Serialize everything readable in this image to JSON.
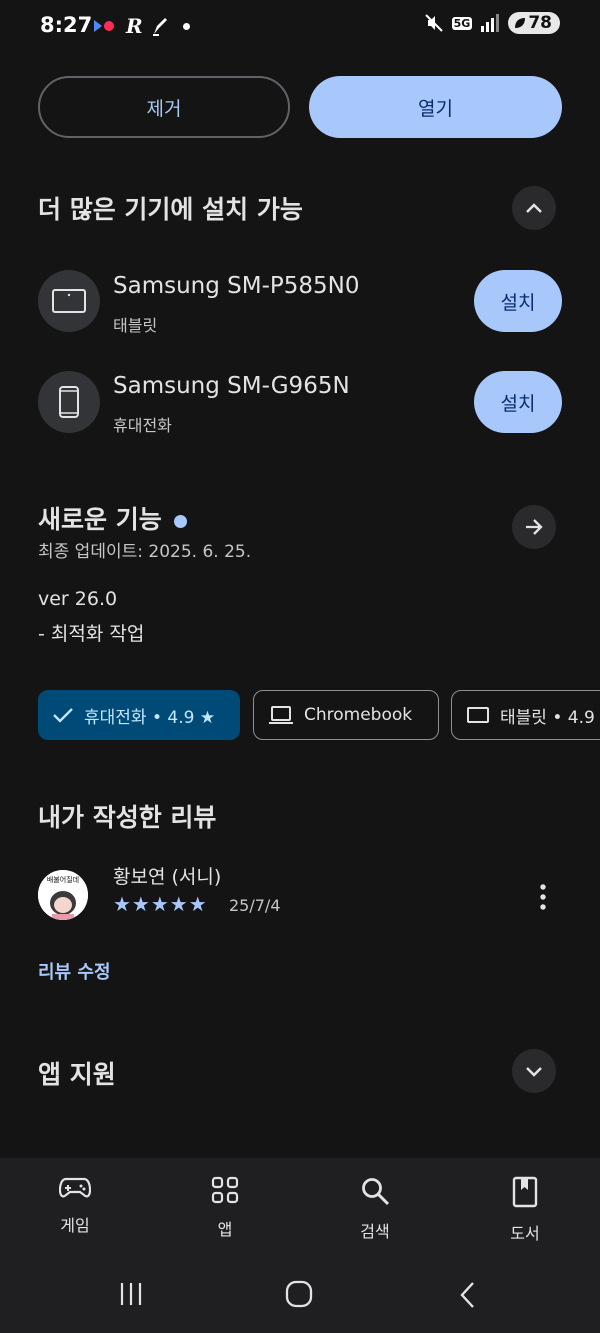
{
  "status_bar": {
    "time": "8:27",
    "network": "5G",
    "battery": "78"
  },
  "actions": {
    "remove_label": "제거",
    "open_label": "열기"
  },
  "devices_section": {
    "title": "더 많은 기기에 설치 가능",
    "devices": [
      {
        "name": "Samsung SM-P585N0",
        "type": "태블릿",
        "button": "설치",
        "icon": "tablet-icon"
      },
      {
        "name": "Samsung SM-G965N",
        "type": "휴대전화",
        "button": "설치",
        "icon": "phone-icon"
      }
    ]
  },
  "whats_new": {
    "title": "새로운 기능",
    "updated": "최종 업데이트: 2025. 6. 25.",
    "version": "ver 26.0",
    "notes": "- 최적화 작업"
  },
  "chips": [
    {
      "label": "휴대전화 • 4.9 ★",
      "icon": "check-icon",
      "selected": true
    },
    {
      "label": "Chromebook",
      "icon": "laptop-icon",
      "selected": false
    },
    {
      "label": "태블릿 • 4.9",
      "icon": "tablet-icon",
      "selected": false
    }
  ],
  "my_review": {
    "title": "내가 작성한 리뷰",
    "reviewer": "황보연 (서니)",
    "rating": 5,
    "stars": "★★★★★",
    "date": "25/7/4",
    "avatar_text": "배불어질데",
    "edit_link": "리뷰 수정"
  },
  "app_support": {
    "title": "앱 지원"
  },
  "bottom_nav": [
    {
      "label": "게임",
      "icon": "gamepad-icon"
    },
    {
      "label": "앱",
      "icon": "apps-grid-icon"
    },
    {
      "label": "검색",
      "icon": "search-icon"
    },
    {
      "label": "도서",
      "icon": "book-icon"
    }
  ],
  "colors": {
    "accent": "#a8c7fa",
    "background": "#141414",
    "chip_selected": "#004a77"
  }
}
